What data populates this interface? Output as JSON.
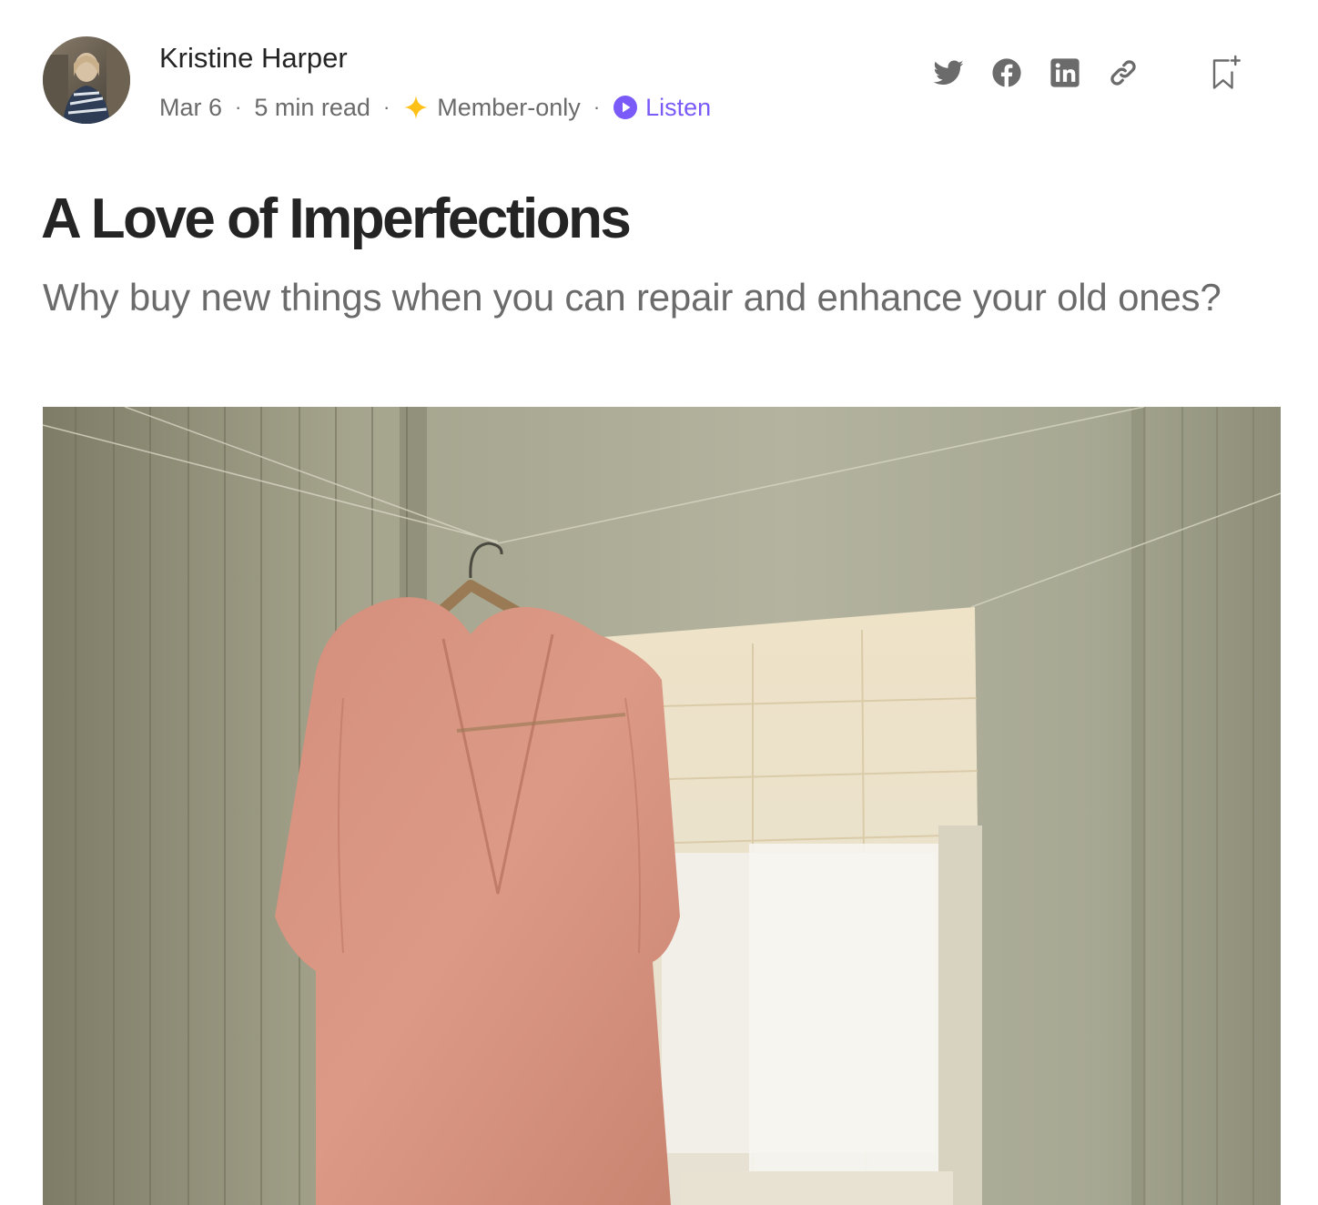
{
  "author": {
    "name": "Kristine Harper"
  },
  "meta": {
    "date": "Mar 6",
    "read_time": "5 min read",
    "separator": "·",
    "membership": "Member-only",
    "listen_label": "Listen"
  },
  "share_icons": [
    "twitter-icon",
    "facebook-icon",
    "linkedin-icon",
    "copy-link-icon",
    "bookmark-icon"
  ],
  "article": {
    "title": "A Love of Imperfections",
    "subtitle": "Why buy new things when you can repair and enhance your old ones?"
  },
  "colors": {
    "text_primary": "#242424",
    "text_secondary": "#6b6b6b",
    "accent_listen": "#7a5af8",
    "member_star": "#ffc017",
    "icon_gray": "#6b6b6b"
  }
}
